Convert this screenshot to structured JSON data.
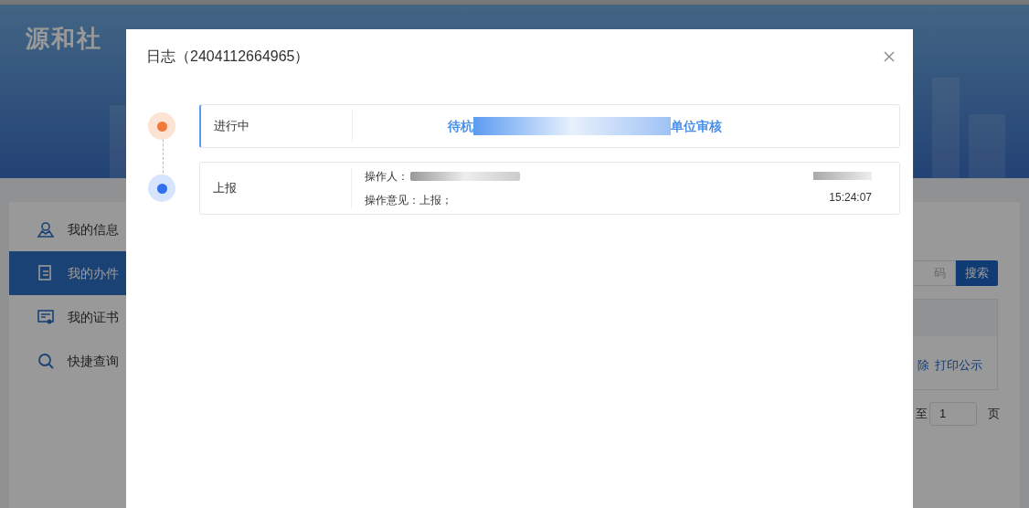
{
  "banner": {
    "title": "源和社"
  },
  "sidebar": {
    "items": [
      {
        "label": "我的信息",
        "selected": false
      },
      {
        "label": "我的办件",
        "selected": true
      },
      {
        "label": "我的证书",
        "selected": false
      },
      {
        "label": "快捷查询",
        "selected": false
      }
    ]
  },
  "search": {
    "placeholder": "码",
    "button": "搜索"
  },
  "table": {
    "actions": [
      "除",
      "打印公示"
    ]
  },
  "pagination": {
    "prefix": "至",
    "page": "1",
    "suffix": "页"
  },
  "dialog": {
    "title": "日志（2404112664965）",
    "timeline": [
      {
        "kind": "current",
        "status": "进行中",
        "message_start": "待杭",
        "message_end": "单位审核"
      },
      {
        "kind": "done",
        "status": "上报",
        "operator_label": "操作人：",
        "opinion": "操作意见：上报；",
        "time": "15:24:07"
      }
    ]
  }
}
